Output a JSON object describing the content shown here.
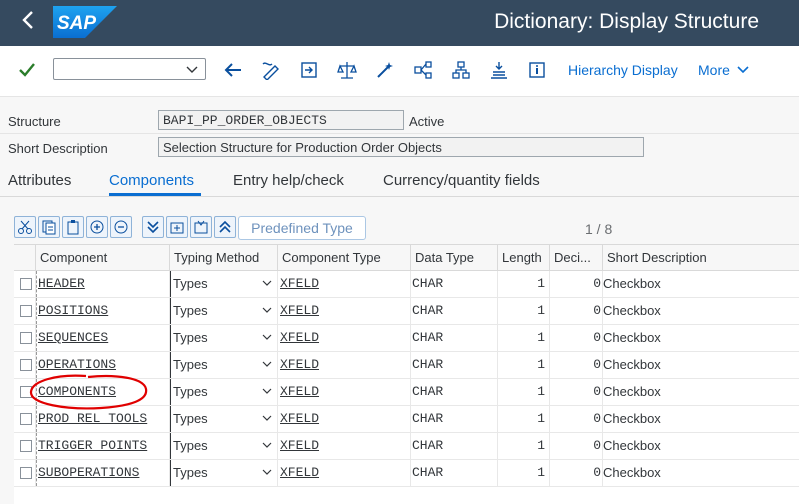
{
  "shell": {
    "title": "Dictionary: Display Structure",
    "logo_text": "SAP"
  },
  "toolbar": {
    "command_field_value": "",
    "hierarchy_label": "Hierarchy Display",
    "more_label": "More"
  },
  "header": {
    "structure_label": "Structure",
    "structure_value": "BAPI_PP_ORDER_OBJECTS",
    "status": "Active",
    "short_desc_label": "Short Description",
    "short_desc_value": "Selection Structure for Production Order Objects"
  },
  "tabs": [
    {
      "label": "Attributes"
    },
    {
      "label": "Components"
    },
    {
      "label": "Entry help/check"
    },
    {
      "label": "Currency/quantity fields"
    }
  ],
  "grid_toolbar": {
    "predefined_type_label": "Predefined Type",
    "pager": "1 / 8"
  },
  "columns": [
    "Component",
    "Typing Method",
    "Component Type",
    "Data Type",
    "Length",
    "Deci...",
    "Short Description"
  ],
  "rows": [
    {
      "component": "HEADER",
      "typing": "Types",
      "ctype": "XFELD",
      "dtype": "CHAR",
      "length": "1",
      "dec": "0",
      "desc": "Checkbox"
    },
    {
      "component": "POSITIONS",
      "typing": "Types",
      "ctype": "XFELD",
      "dtype": "CHAR",
      "length": "1",
      "dec": "0",
      "desc": "Checkbox"
    },
    {
      "component": "SEQUENCES",
      "typing": "Types",
      "ctype": "XFELD",
      "dtype": "CHAR",
      "length": "1",
      "dec": "0",
      "desc": "Checkbox"
    },
    {
      "component": "OPERATIONS",
      "typing": "Types",
      "ctype": "XFELD",
      "dtype": "CHAR",
      "length": "1",
      "dec": "0",
      "desc": "Checkbox"
    },
    {
      "component": "COMPONENTS",
      "typing": "Types",
      "ctype": "XFELD",
      "dtype": "CHAR",
      "length": "1",
      "dec": "0",
      "desc": "Checkbox"
    },
    {
      "component": "PROD_REL_TOOLS",
      "typing": "Types",
      "ctype": "XFELD",
      "dtype": "CHAR",
      "length": "1",
      "dec": "0",
      "desc": "Checkbox"
    },
    {
      "component": "TRIGGER_POINTS",
      "typing": "Types",
      "ctype": "XFELD",
      "dtype": "CHAR",
      "length": "1",
      "dec": "0",
      "desc": "Checkbox"
    },
    {
      "component": "SUBOPERATIONS",
      "typing": "Types",
      "ctype": "XFELD",
      "dtype": "CHAR",
      "length": "1",
      "dec": "0",
      "desc": "Checkbox"
    }
  ],
  "colors": {
    "shell": "#354a5f",
    "accent": "#0a6ed1",
    "annotation": "#e00000"
  }
}
